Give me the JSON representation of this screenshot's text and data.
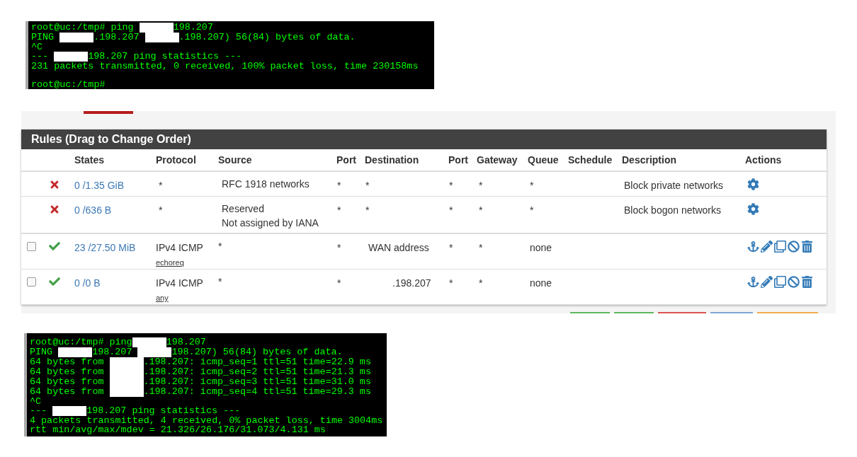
{
  "terminal_top": {
    "lines": [
      {
        "kind": "text",
        "segments": [
          {
            "kind": "text",
            "text": "root@uc:/tmp# ping "
          },
          {
            "kind": "redacted"
          },
          {
            "kind": "text",
            "text": "198.207"
          }
        ]
      },
      {
        "kind": "text",
        "segments": [
          {
            "kind": "text",
            "text": "PING "
          },
          {
            "kind": "redacted"
          },
          {
            "kind": "text",
            "text": ".198.207 "
          },
          {
            "kind": "redacted"
          },
          {
            "kind": "text",
            "text": ".198.207) 56(84) bytes of data."
          }
        ]
      },
      {
        "kind": "text",
        "segments": [
          {
            "kind": "text",
            "text": "^C"
          }
        ]
      },
      {
        "kind": "text",
        "segments": [
          {
            "kind": "text",
            "text": "--- "
          },
          {
            "kind": "redacted"
          },
          {
            "kind": "text",
            "text": "198.207 ping statistics ---"
          }
        ]
      },
      {
        "kind": "text",
        "segments": [
          {
            "kind": "text",
            "text": "231 packets transmitted, 0 received, 100% packet loss, time 230158ms"
          }
        ]
      },
      {
        "kind": "blank"
      },
      {
        "kind": "text",
        "segments": [
          {
            "kind": "text",
            "text": "root@uc:/tmp#"
          }
        ]
      }
    ]
  },
  "rules": {
    "title": "Rules (Drag to Change Order)",
    "columns": [
      "States",
      "Protocol",
      "Source",
      "Port",
      "Destination",
      "Port",
      "Gateway",
      "Queue",
      "Schedule",
      "Description",
      "Actions"
    ],
    "rows": [
      {
        "kind": "block",
        "states": "0 /1.35 GiB",
        "protocol": "*",
        "source": [
          "RFC 1918 networks"
        ],
        "port": "*",
        "destination": "*",
        "dest_port": "*",
        "gateway": "*",
        "queue": "*",
        "description": "Block private networks"
      },
      {
        "kind": "block",
        "states": "0 /636 B",
        "protocol": "*",
        "source": [
          "Reserved",
          "Not assigned by IANA"
        ],
        "port": "*",
        "destination": "*",
        "dest_port": "*",
        "gateway": "*",
        "queue": "*",
        "description": "Block bogon networks"
      },
      {
        "kind": "pass",
        "checked": false,
        "states": "23 /27.50 MiB",
        "protocol": "IPv4 ICMP",
        "icmp_type": "echoreq",
        "source": [
          "*"
        ],
        "port": "*",
        "destination": "WAN address",
        "dest_port": "*",
        "gateway": "*",
        "queue": "none"
      },
      {
        "kind": "pass",
        "checked": false,
        "states": "0 /0 B",
        "protocol": "IPv4 ICMP",
        "icmp_type": "any",
        "source": [
          "*"
        ],
        "port": "*",
        "destination": ".198.207",
        "dest_port": "*",
        "gateway": "*",
        "queue": "none"
      }
    ]
  },
  "terminal_bottom": {
    "lines": [
      {
        "kind": "text",
        "segments": [
          {
            "kind": "text",
            "text": "root@uc:/tmp# ping"
          },
          {
            "kind": "redacted"
          },
          {
            "kind": "text",
            "text": "198.207"
          }
        ]
      },
      {
        "kind": "text",
        "segments": [
          {
            "kind": "text",
            "text": "PING "
          },
          {
            "kind": "redacted"
          },
          {
            "kind": "text",
            "text": "198.207 "
          },
          {
            "kind": "redacted"
          },
          {
            "kind": "text",
            "text": "198.207) 56(84) bytes of data."
          }
        ]
      },
      {
        "kind": "text",
        "segments": [
          {
            "kind": "text",
            "text": "64 bytes from "
          },
          {
            "kind": "redacted"
          },
          {
            "kind": "text",
            "text": ".198.207: icmp_seq=1 ttl=51 time=22.9 ms"
          }
        ]
      },
      {
        "kind": "text",
        "segments": [
          {
            "kind": "text",
            "text": "64 bytes from "
          },
          {
            "kind": "redacted"
          },
          {
            "kind": "text",
            "text": ".198.207: icmp_seq=2 ttl=51 time=21.3 ms"
          }
        ]
      },
      {
        "kind": "text",
        "segments": [
          {
            "kind": "text",
            "text": "64 bytes from "
          },
          {
            "kind": "redacted"
          },
          {
            "kind": "text",
            "text": ".198.207: icmp_seq=3 ttl=51 time=31.0 ms"
          }
        ]
      },
      {
        "kind": "text",
        "segments": [
          {
            "kind": "text",
            "text": "64 bytes from "
          },
          {
            "kind": "redacted"
          },
          {
            "kind": "text",
            "text": ".198.207: icmp_seq=4 ttl=51 time=29.3 ms"
          }
        ]
      },
      {
        "kind": "text",
        "segments": [
          {
            "kind": "text",
            "text": "^C"
          }
        ]
      },
      {
        "kind": "text",
        "segments": [
          {
            "kind": "text",
            "text": "--- "
          },
          {
            "kind": "redacted"
          },
          {
            "kind": "text",
            "text": "198.207 ping statistics ---"
          }
        ]
      },
      {
        "kind": "text",
        "segments": [
          {
            "kind": "text",
            "text": "4 packets transmitted, 4 received, 0% packet loss, time 3004ms"
          }
        ]
      },
      {
        "kind": "text",
        "segments": [
          {
            "kind": "text",
            "text": "rtt min/avg/max/mdev = 21.326/26.176/31.073/4.131 ms"
          }
        ]
      }
    ]
  }
}
